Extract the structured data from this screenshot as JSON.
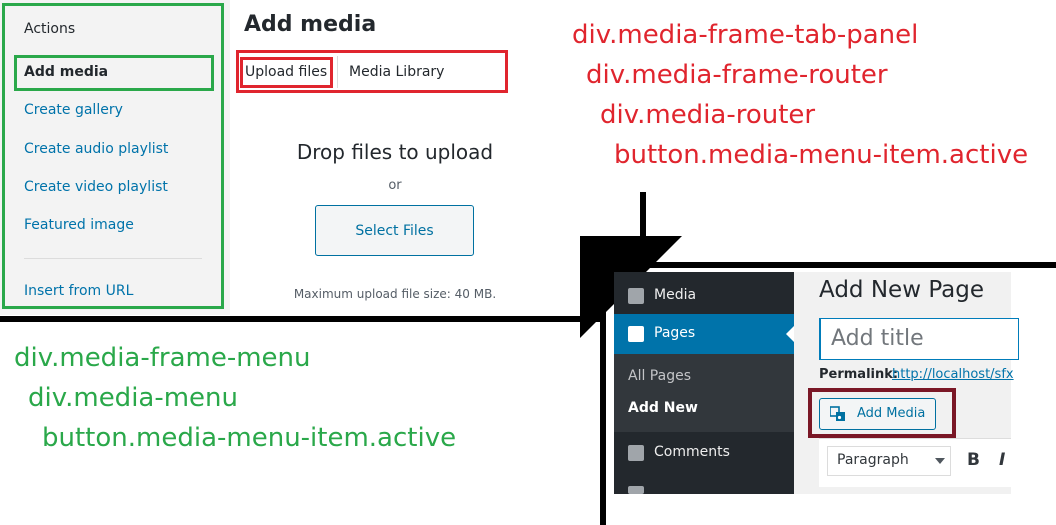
{
  "media_modal": {
    "menu": {
      "heading": "Actions",
      "items": [
        {
          "label": "Add media"
        },
        {
          "label": "Create gallery"
        },
        {
          "label": "Create audio playlist"
        },
        {
          "label": "Create video playlist"
        },
        {
          "label": "Featured image"
        },
        {
          "label": "Insert from URL"
        }
      ]
    },
    "title": "Add media",
    "router_tabs": [
      {
        "label": "Upload files"
      },
      {
        "label": "Media Library"
      }
    ],
    "uploader": {
      "drop_text": "Drop files to upload",
      "or_text": "or",
      "select_button": "Select Files",
      "max_size_text": "Maximum upload file size: 40 MB."
    }
  },
  "annotations": {
    "red": [
      "div.media-frame-tab-panel",
      "div.media-frame-router",
      "div.media-router",
      "button.media-menu-item.active"
    ],
    "green": [
      "div.media-frame-menu",
      "div.media-menu",
      "button.media-menu-item.active"
    ]
  },
  "colors": {
    "annotation_red": "#e0252e",
    "annotation_green": "#2aa84a",
    "highlight_maroon": "#7a1726",
    "wp_blue": "#0073aa"
  },
  "wp_admin": {
    "sidebar": {
      "items": [
        {
          "label": "Media",
          "icon": "media-icon"
        },
        {
          "label": "Pages",
          "icon": "pages-icon",
          "active": true
        },
        {
          "label": "Comments",
          "icon": "comments-icon"
        }
      ],
      "submenu": [
        {
          "label": "All Pages"
        },
        {
          "label": "Add New",
          "current": true
        }
      ]
    },
    "page_title": "Add New Page",
    "title_placeholder": "Add title",
    "permalink_label": "Permalink:",
    "permalink_url": "http://localhost/sfx",
    "add_media_button": "Add Media",
    "toolbar": {
      "format_select": "Paragraph",
      "bold": "B",
      "italic": "I"
    }
  }
}
